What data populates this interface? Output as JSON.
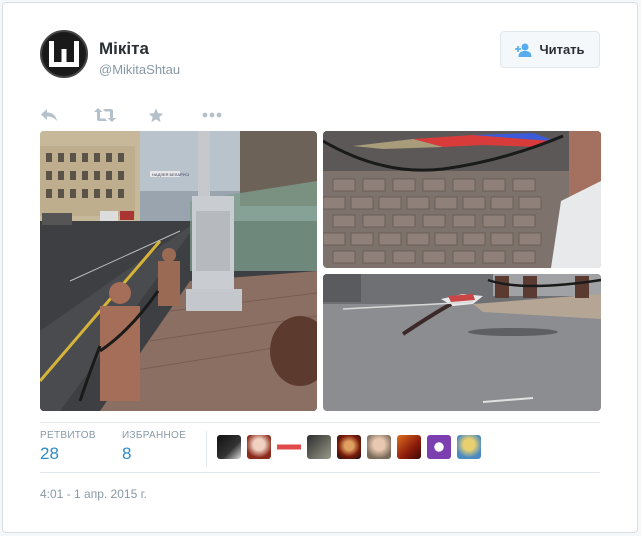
{
  "user": {
    "name": "Мікіта",
    "handle": "@MikitaShtau"
  },
  "follow_button": {
    "label": "Читать",
    "icon": "add-user-icon"
  },
  "actions": [
    "reply-icon",
    "retweet-icon",
    "favorite-icon",
    "more-icon"
  ],
  "media": {
    "sign_text": "НАДЗЕЯ БЕЛАРУСІ",
    "images": [
      "street-photo",
      "flag-on-pavement-photo",
      "flag-on-asphalt-photo"
    ]
  },
  "stats": {
    "retweets_label": "РЕТВИТОВ",
    "retweets_value": "28",
    "favorites_label": "ИЗБРАННОЕ",
    "favorites_value": "8"
  },
  "timestamp": "4:01 - 1 апр. 2015 г.",
  "colors": {
    "link": "#2a8dc8",
    "muted": "#8899a6",
    "text": "#292f33",
    "follow_icon": "#55acee"
  }
}
